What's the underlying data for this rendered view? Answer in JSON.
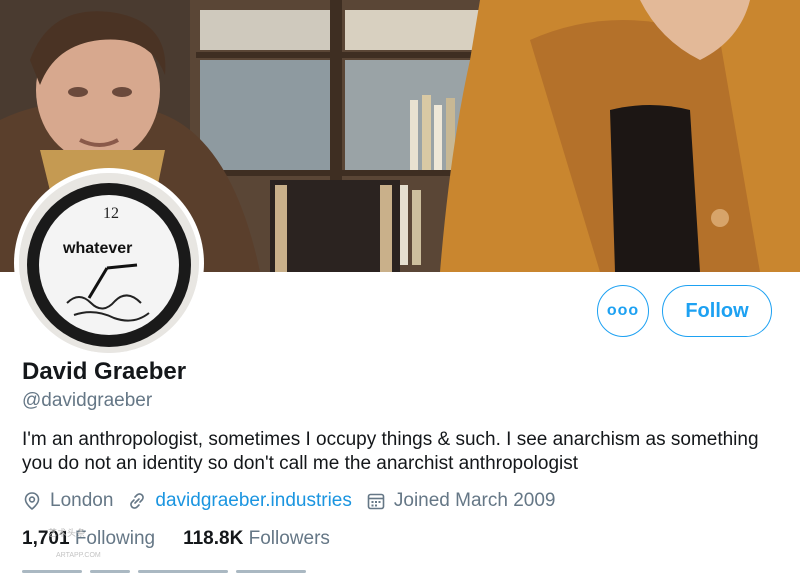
{
  "profile": {
    "name": "David Graeber",
    "handle": "@davidgraeber",
    "bio": "I'm an anthropologist, sometimes I occupy things & such. I see anarchism as something you do not an identity so don't call me the anarchist anthropologist",
    "location": "London",
    "website": "davidgraeber.industries",
    "joined": "Joined March 2009"
  },
  "stats": {
    "following_count": "1,701",
    "following_label": "Following",
    "followers_count": "118.8K",
    "followers_label": "Followers"
  },
  "actions": {
    "more_label": "ooo",
    "follow_label": "Follow"
  },
  "avatar": {
    "clock_number": "12",
    "clock_text": "whatever"
  },
  "watermark": {
    "text": "艺术头条",
    "domain": "ARTAPP.COM"
  },
  "colors": {
    "accent": "#1da1f2",
    "link": "#1b95e0",
    "secondary_text": "#657786",
    "primary_text": "#14171a"
  },
  "icons": {
    "location": "map-pin-icon",
    "website": "link-icon",
    "joined": "calendar-icon",
    "more": "more-options-icon"
  }
}
